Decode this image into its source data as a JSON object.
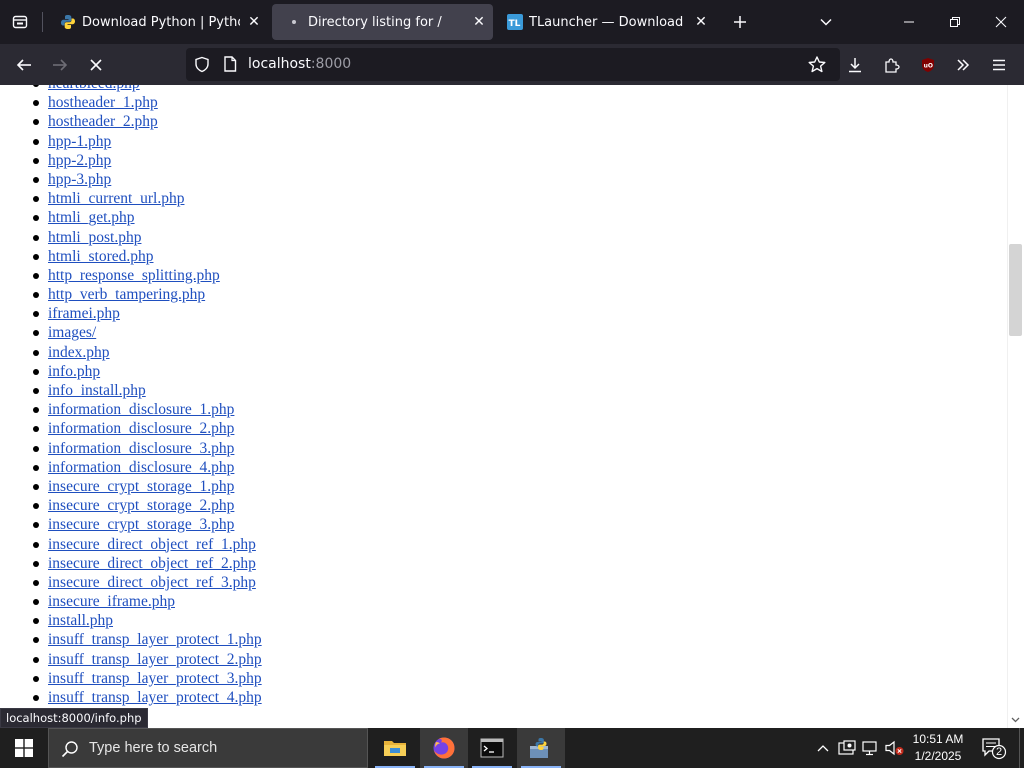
{
  "browser": {
    "tabs": [
      {
        "title": "Download Python | Python.org",
        "active": false
      },
      {
        "title": "Directory listing for /",
        "active": true
      },
      {
        "title": "TLauncher — Download Minecraft",
        "active": false
      }
    ],
    "url_host": "localhost",
    "url_port": ":8000",
    "status_url": "localhost:8000/info.php"
  },
  "listing": {
    "items": [
      "heartbleed.php",
      "hostheader_1.php",
      "hostheader_2.php",
      "hpp-1.php",
      "hpp-2.php",
      "hpp-3.php",
      "htmli_current_url.php",
      "htmli_get.php",
      "htmli_post.php",
      "htmli_stored.php",
      "http_response_splitting.php",
      "http_verb_tampering.php",
      "iframei.php",
      "images/",
      "index.php",
      "info.php",
      "info_install.php",
      "information_disclosure_1.php",
      "information_disclosure_2.php",
      "information_disclosure_3.php",
      "information_disclosure_4.php",
      "insecure_crypt_storage_1.php",
      "insecure_crypt_storage_2.php",
      "insecure_crypt_storage_3.php",
      "insecure_direct_object_ref_1.php",
      "insecure_direct_object_ref_2.php",
      "insecure_direct_object_ref_3.php",
      "insecure_iframe.php",
      "install.php",
      "insuff_transp_layer_protect_1.php",
      "insuff_transp_layer_protect_2.php",
      "insuff_transp_layer_protect_3.php",
      "insuff_transp_layer_protect_4.php"
    ]
  },
  "taskbar": {
    "search_placeholder": "Type here to search",
    "time": "10:51 AM",
    "date": "1/2/2025",
    "notification_count": "2"
  },
  "colors": {
    "link": "#1f4fbf",
    "tab_active": "#42414d",
    "toolbar": "#2b2a33",
    "tabstrip": "#1c1b22"
  }
}
